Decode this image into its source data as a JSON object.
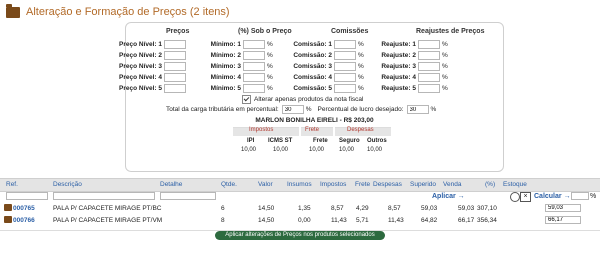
{
  "page": {
    "title": "Alteração e Formação de Preços (2 itens)"
  },
  "precos": {
    "header": "Preços",
    "labels": [
      "Preço Nível: 1",
      "Preço Nível: 2",
      "Preço Nível: 3",
      "Preço Nível: 4",
      "Preço Nível: 5"
    ]
  },
  "sobre": {
    "header": "(%) Sob o Preço",
    "labels": [
      "Mínimo: 1",
      "Mínimo: 2",
      "Mínimo: 3",
      "Mínimo: 4",
      "Mínimo: 5"
    ]
  },
  "comissoes": {
    "header": "Comissões",
    "labels": [
      "Comissão: 1",
      "Comissão: 2",
      "Comissão: 3",
      "Comissão: 4",
      "Comissão: 5"
    ]
  },
  "reajustes": {
    "header": "Reajustes de Preços",
    "labels": [
      "Reajuste: 1",
      "Reajuste: 2",
      "Reajuste: 3",
      "Reajuste: 4",
      "Reajuste: 5"
    ]
  },
  "pct_sign": "%",
  "options": {
    "alterar_apenas": "Alterar apenas produtos da nota fiscal",
    "carga_label": "Total da carga tributária em percentual:",
    "carga_value": "30",
    "lucro_label": "Percentual de lucro desejado:",
    "lucro_value": "30",
    "supplier": "MARLON BONILHA EIRELI - R$ 203,00"
  },
  "tax_table": {
    "groups": [
      "Impostos",
      "Frete",
      "Despesas"
    ],
    "cols": [
      "IPI",
      "ICMS ST",
      "Frete",
      "Seguro",
      "Outros"
    ],
    "values": [
      "10,00",
      "10,00",
      "10,00",
      "10,00",
      "10,00"
    ]
  },
  "grid": {
    "headers": {
      "ref": "Ref.",
      "descricao": "Descrição",
      "detalhe": "Detalhe",
      "qtde": "Qtde.",
      "valor": "Valor",
      "insumos": "Insumos",
      "impostos": "Impostos",
      "frete": "Frete",
      "despesas": "Despesas",
      "superido": "Superido",
      "venda": "Venda",
      "pct": "(%)",
      "estoque": "Estoque"
    },
    "aplicar": "Aplicar →",
    "calcular": "Calcular →",
    "rows": [
      {
        "ref": "000765",
        "descricao": "PALA P/ CAPACETE MIRAGE PT/BC",
        "qtde": "6",
        "valor": "14,50",
        "insumos": "1,35",
        "impostos": "8,57",
        "frete": "4,29",
        "despesas": "8,57",
        "superido": "59,03",
        "venda": "59,03",
        "pct": "307,10",
        "input": "59,03"
      },
      {
        "ref": "000766",
        "descricao": "PALA P/ CAPACETE MIRAGE PT/VM",
        "qtde": "8",
        "valor": "14,50",
        "insumos": "0,00",
        "impostos": "11,43",
        "frete": "5,71",
        "despesas": "11,43",
        "superido": "64,82",
        "venda": "66,17",
        "pct": "356,34",
        "input": "66,17"
      }
    ]
  },
  "apply_button": "Aplicar alterações de Preços nos produtos selecionados"
}
